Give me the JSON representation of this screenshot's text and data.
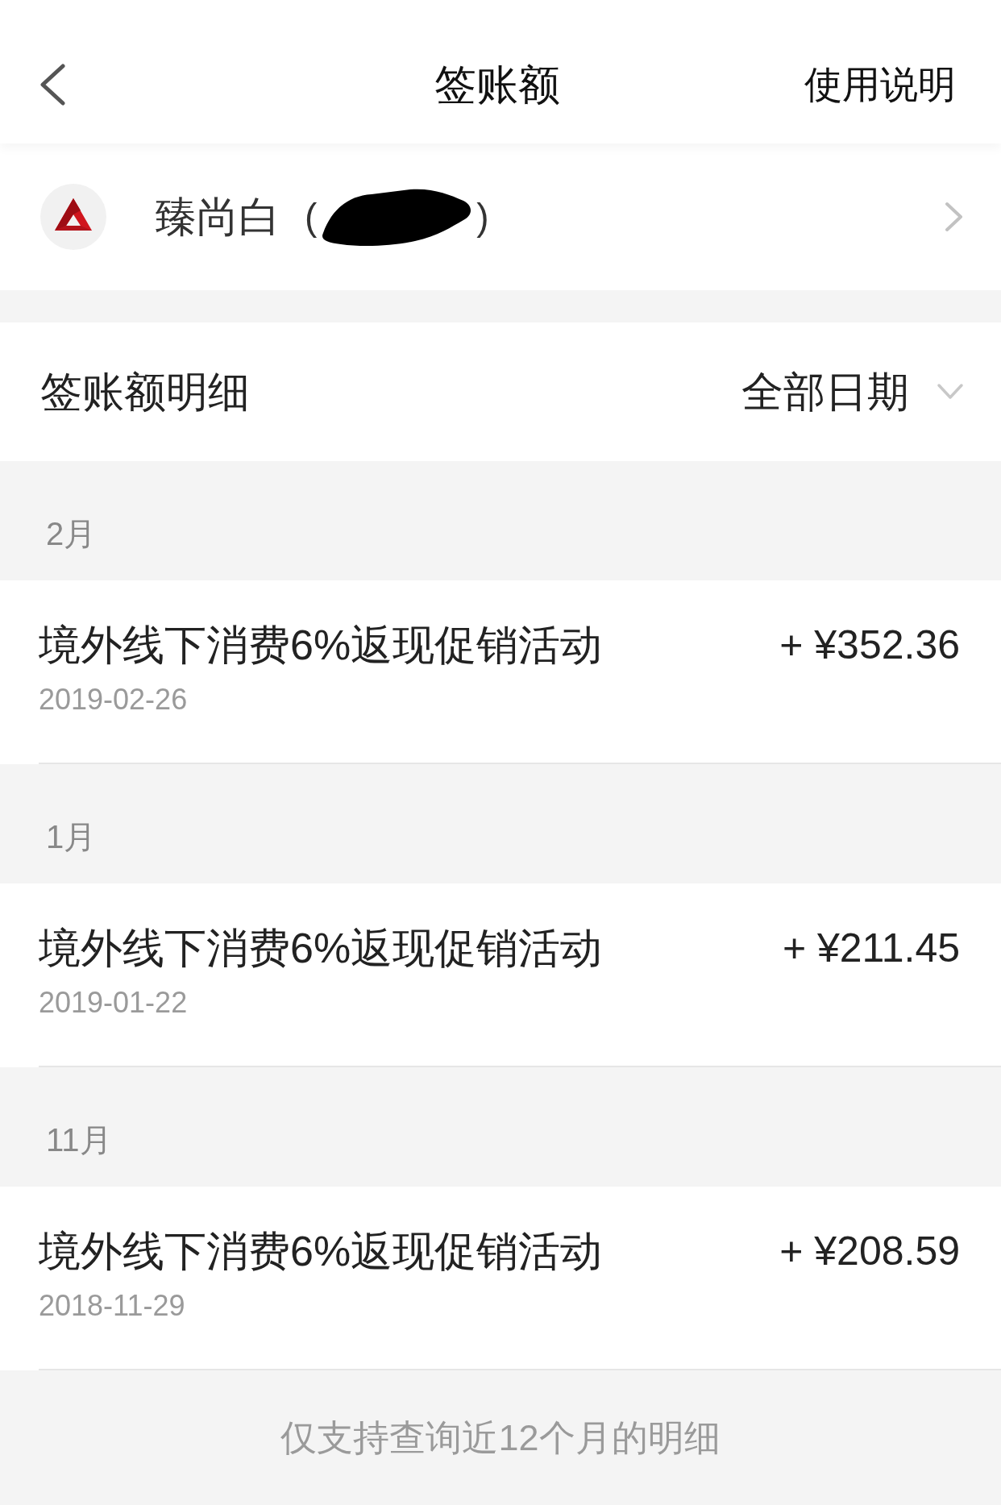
{
  "nav": {
    "title": "签账额",
    "action": "使用说明"
  },
  "card": {
    "name": "臻尚白",
    "number_open": "(",
    "number_close": ")",
    "redacted": true
  },
  "details": {
    "title": "签账额明细",
    "filter": "全部日期"
  },
  "groups": [
    {
      "month": "2月",
      "items": [
        {
          "title": "境外线下消费6%返现促销活动",
          "date": "2019-02-26",
          "amount": "+ ¥352.36"
        }
      ]
    },
    {
      "month": "1月",
      "items": [
        {
          "title": "境外线下消费6%返现促销活动",
          "date": "2019-01-22",
          "amount": "+ ¥211.45"
        }
      ]
    },
    {
      "month": "11月",
      "items": [
        {
          "title": "境外线下消费6%返现促销活动",
          "date": "2018-11-29",
          "amount": "+ ¥208.59"
        }
      ]
    }
  ],
  "footer": "仅支持查询近12个月的明细"
}
